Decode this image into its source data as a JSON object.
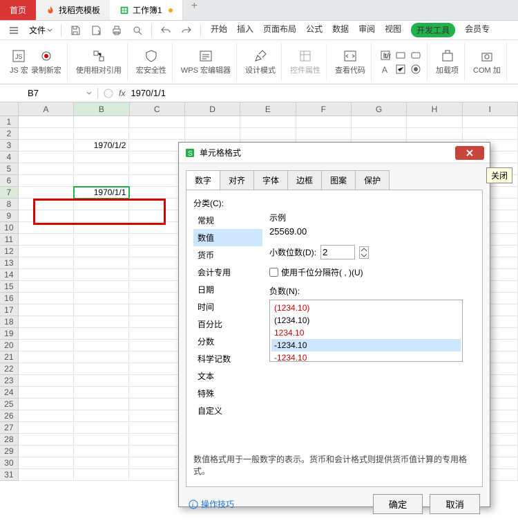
{
  "tabs": {
    "home": "首页",
    "t2": "找稻壳模板",
    "t3": "工作簿1"
  },
  "menu": {
    "file": "文件",
    "items": [
      "开始",
      "插入",
      "页面布局",
      "公式",
      "数据",
      "审阅",
      "视图"
    ],
    "dev": "开发工具",
    "member": "会员专"
  },
  "ribbon": {
    "js": "JS 宏",
    "rec": "录制新宏",
    "rel": "使用相对引用",
    "sec": "宏安全性",
    "wps": "WPS 宏编辑器",
    "design": "设计模式",
    "ctrl": "控件属性",
    "code": "查看代码",
    "addin": "加载项",
    "com": "COM 加"
  },
  "cellref": "B7",
  "fx": "1970/1/1",
  "cols": [
    "A",
    "B",
    "C",
    "D",
    "E",
    "F",
    "G",
    "H",
    "I"
  ],
  "cells": {
    "b3": "1970/1/2",
    "b7": "1970/1/1"
  },
  "dlg": {
    "title": "单元格格式",
    "tabs": [
      "数字",
      "对齐",
      "字体",
      "边框",
      "图案",
      "保护"
    ],
    "cat_label": "分类(C):",
    "cats": [
      "常规",
      "数值",
      "货币",
      "会计专用",
      "日期",
      "时间",
      "百分比",
      "分数",
      "科学记数",
      "文本",
      "特殊",
      "自定义"
    ],
    "sample_lbl": "示例",
    "sample_val": "25569.00",
    "dec_lbl": "小数位数(D):",
    "dec_val": "2",
    "chk": "使用千位分隔符( , )(U)",
    "neg_lbl": "负数(N):",
    "negs": [
      "(1234.10)",
      "(1234.10)",
      "1234.10",
      "-1234.10",
      "-1234.10"
    ],
    "desc": "数值格式用于一般数字的表示。货币和会计格式则提供货币值计算的专用格式。",
    "tip": "操作技巧",
    "ok": "确定",
    "cancel": "取消"
  },
  "tooltip": "关闭"
}
